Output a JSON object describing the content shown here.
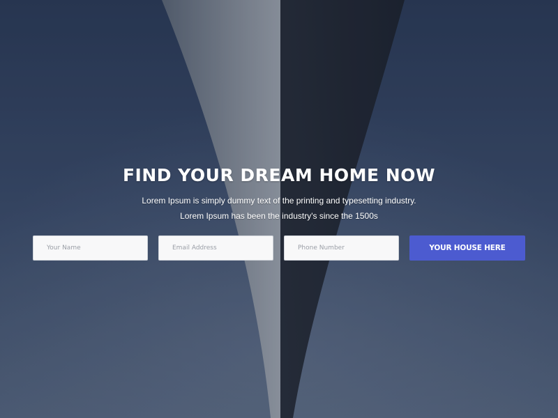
{
  "hero": {
    "headline": "FIND YOUR DREAM HOME NOW",
    "subline_1": "Lorem Ipsum is simply dummy text of the printing and typesetting industry.",
    "subline_2": "Lorem Ipsum has been the industry's since the 1500s"
  },
  "form": {
    "name_placeholder": "Your Name",
    "email_placeholder": "Email Address",
    "phone_placeholder": "Phone Number",
    "submit_label": "YOUR HOUSE HERE"
  },
  "colors": {
    "accent": "#4c5bd0",
    "text": "#ffffff",
    "field_bg": "#f8f8f9"
  }
}
